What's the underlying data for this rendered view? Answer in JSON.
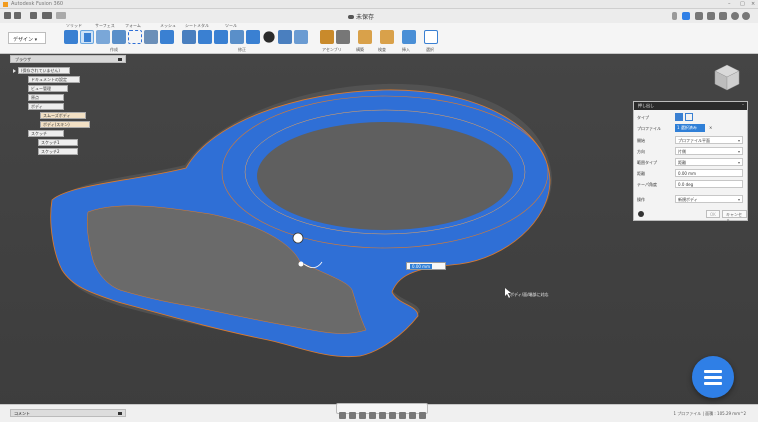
{
  "app": {
    "title": "Autodesk Fusion 360",
    "document_title": "未保存"
  },
  "ribbon": {
    "workspace": "デザイン",
    "tabs": [
      "ソリッド",
      "サーフェス",
      "フォーム",
      "メッシュ",
      "シートメタル",
      "ツール"
    ],
    "groups": [
      "作成",
      "修正",
      "アセンブリ",
      "構築",
      "検査",
      "挿入",
      "選択"
    ]
  },
  "browser": {
    "header": "ブラウザ",
    "items": [
      "(保存されていません)",
      "ドキュメントの設定",
      "ビュー管理",
      "原点",
      "ボディ",
      "スムーズボディ",
      "ボディ(スキン)",
      "スケッチ",
      "スケッチ1",
      "スケッチ2"
    ]
  },
  "dialog": {
    "title": "押し出し",
    "rows": [
      {
        "label": "タイプ",
        "value": ""
      },
      {
        "label": "プロファイル",
        "value": "1 選択済み"
      },
      {
        "label": "開始",
        "value": "プロファイル平面"
      },
      {
        "label": "方向",
        "value": "片側"
      },
      {
        "label": "範囲タイプ",
        "value": "距離"
      },
      {
        "label": "距離",
        "value": "0.00 mm"
      },
      {
        "label": "テーパ角度",
        "value": "0.0 deg"
      },
      {
        "label": "操作",
        "value": "新規ボディ"
      }
    ],
    "ok": "OK",
    "cancel": "キャンセル"
  },
  "viewport": {
    "distance_input": "0.00 mm",
    "hint": "ボディ/面/端部に対応"
  },
  "bottombar": {
    "comments": "コメント",
    "status": "1 プロファイル | 面積 : 105.29 mm^2"
  },
  "colors": {
    "selection_blue": "#2f6fd6",
    "accent_orange": "#e07b2a",
    "fab": "#2f7fe6"
  }
}
